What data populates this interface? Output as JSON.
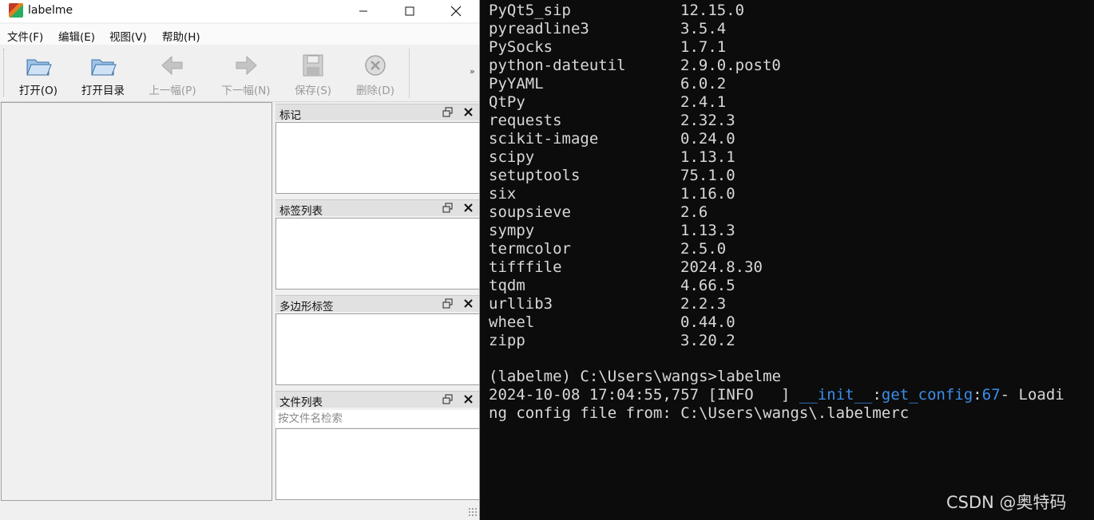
{
  "window": {
    "title": "labelme",
    "controls": {
      "minimize": "—",
      "maximize": "☐",
      "close": "✕"
    }
  },
  "menu": [
    "文件(F)",
    "编辑(E)",
    "视图(V)",
    "帮助(H)"
  ],
  "toolbar": {
    "open": "打开(O)",
    "open_dir": "打开目录",
    "prev": "上一幅(P)",
    "next": "下一幅(N)",
    "save": "保存(S)",
    "delete": "删除(D)",
    "more": "»"
  },
  "docks": {
    "flags": "标记",
    "label_list": "标签列表",
    "polygon_labels": "多边形标签",
    "file_list": "文件列表",
    "file_search_placeholder": "按文件名检索"
  },
  "terminal": {
    "packages": [
      {
        "name": "PyQt5_sip",
        "version": "12.15.0"
      },
      {
        "name": "pyreadline3",
        "version": "3.5.4"
      },
      {
        "name": "PySocks",
        "version": "1.7.1"
      },
      {
        "name": "python-dateutil",
        "version": "2.9.0.post0"
      },
      {
        "name": "PyYAML",
        "version": "6.0.2"
      },
      {
        "name": "QtPy",
        "version": "2.4.1"
      },
      {
        "name": "requests",
        "version": "2.32.3"
      },
      {
        "name": "scikit-image",
        "version": "0.24.0"
      },
      {
        "name": "scipy",
        "version": "1.13.1"
      },
      {
        "name": "setuptools",
        "version": "75.1.0"
      },
      {
        "name": "six",
        "version": "1.16.0"
      },
      {
        "name": "soupsieve",
        "version": "2.6"
      },
      {
        "name": "sympy",
        "version": "1.13.3"
      },
      {
        "name": "termcolor",
        "version": "2.5.0"
      },
      {
        "name": "tifffile",
        "version": "2024.8.30"
      },
      {
        "name": "tqdm",
        "version": "4.66.5"
      },
      {
        "name": "urllib3",
        "version": "2.2.3"
      },
      {
        "name": "wheel",
        "version": "0.44.0"
      },
      {
        "name": "zipp",
        "version": "3.20.2"
      }
    ],
    "prompt": "(labelme) C:\\Users\\wangs>labelme",
    "log_timestamp": "2024-10-08 17:04:55,757 [INFO   ] ",
    "log_module": "__init__",
    "log_sep1": ":",
    "log_func": "get_config",
    "log_sep2": ":",
    "log_lineno": "67",
    "log_msg_part1": "- Loadi",
    "log_msg_part2": "ng config file from: C:\\Users\\wangs\\.labelmerc",
    "link_color": "#3b8eea"
  },
  "watermark": "CSDN @奥特码"
}
